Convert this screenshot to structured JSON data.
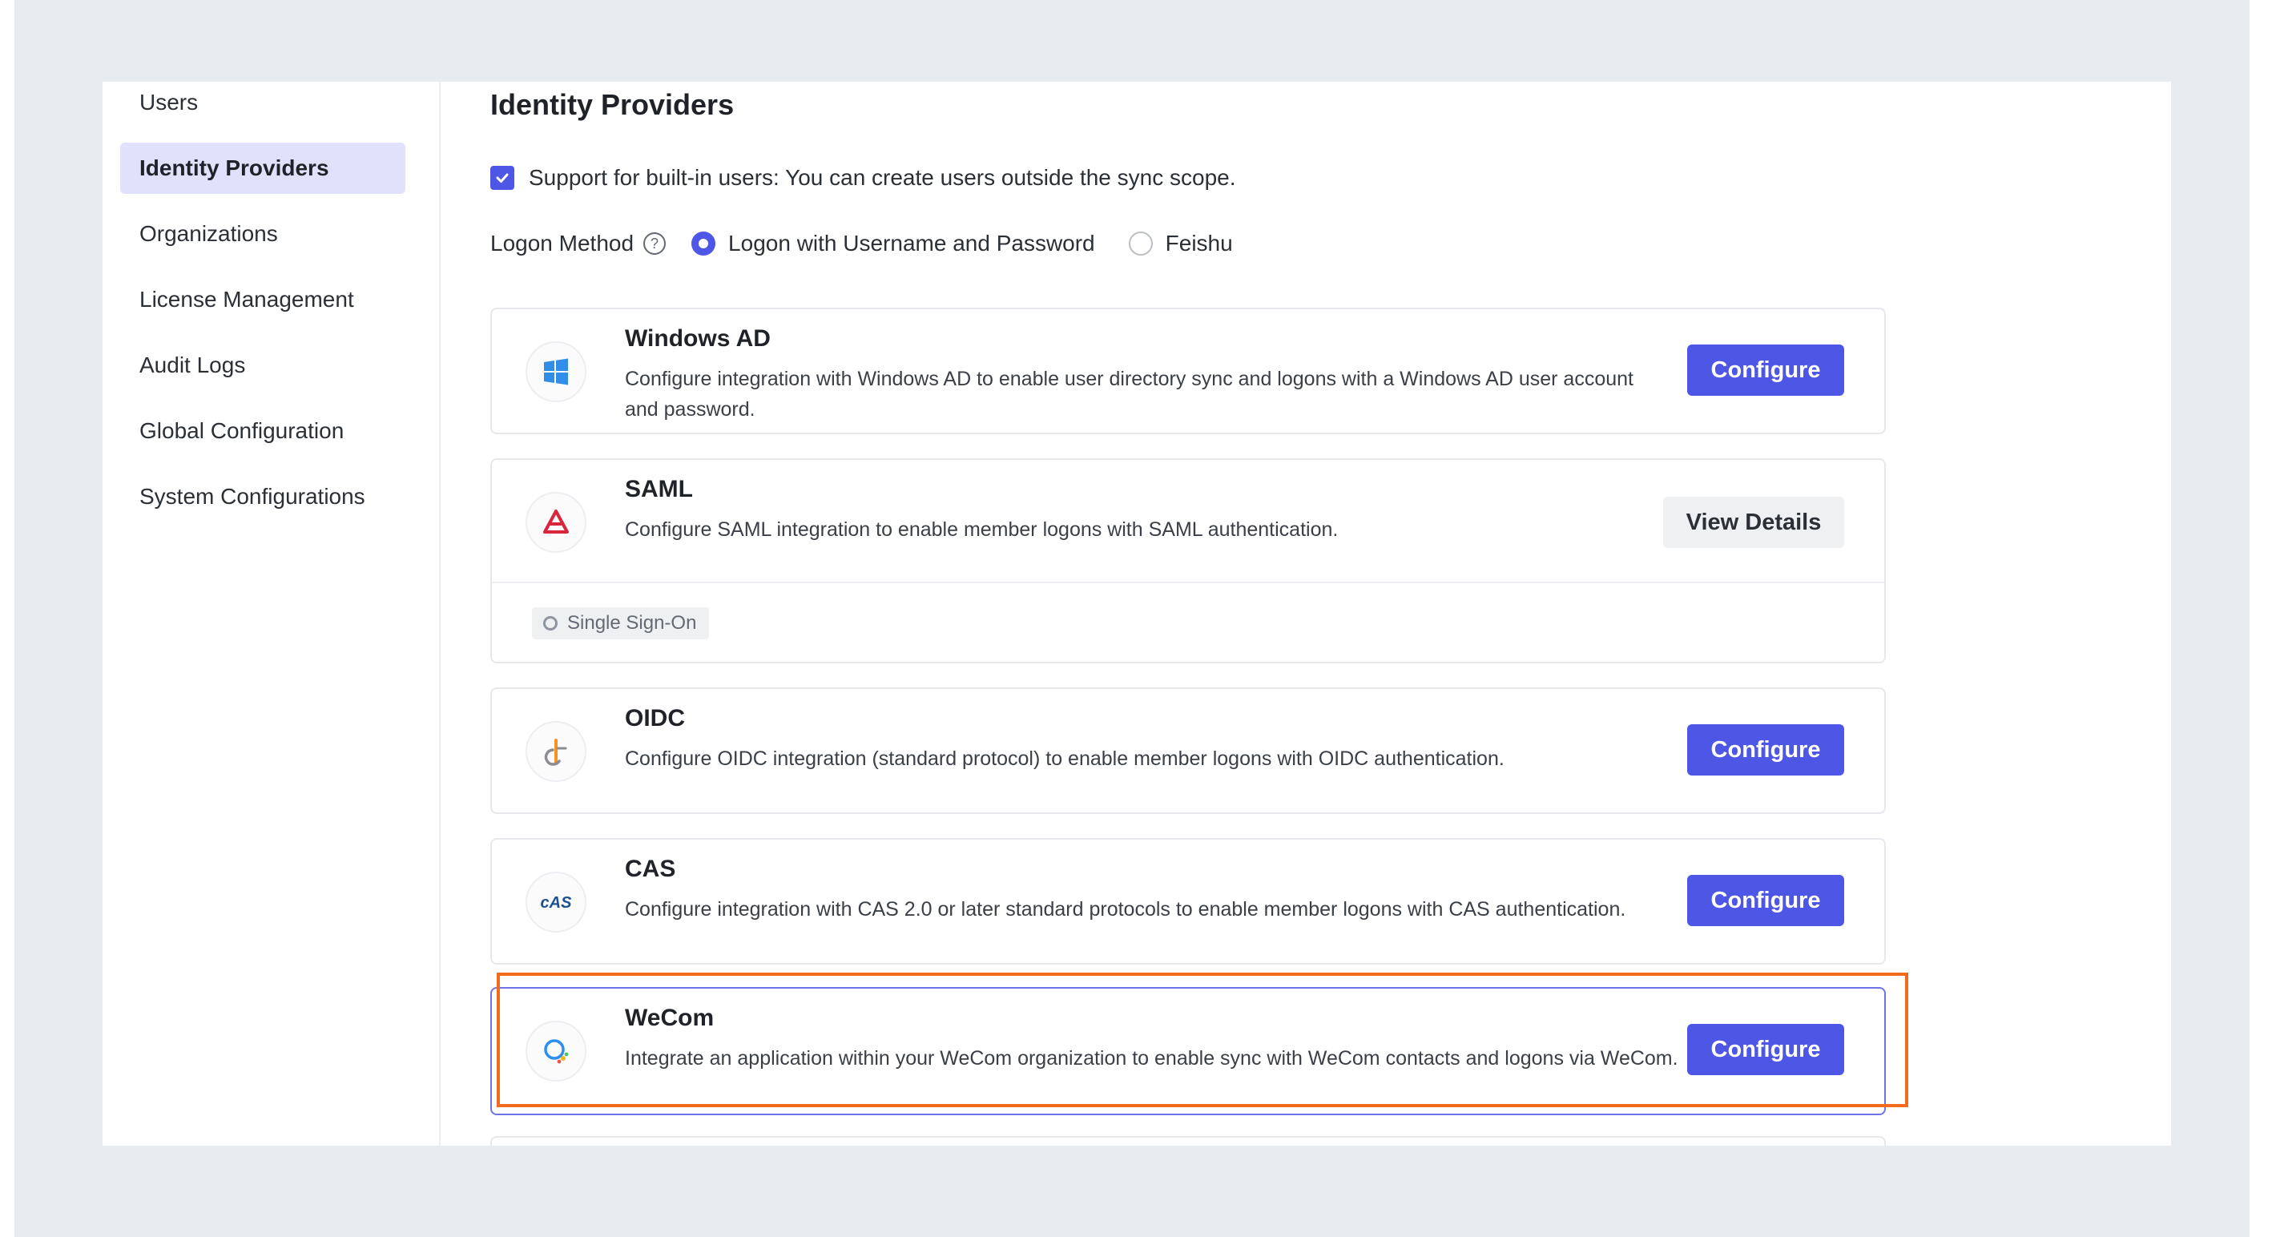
{
  "sidebar": {
    "items": [
      {
        "label": "Users"
      },
      {
        "label": "Identity Providers"
      },
      {
        "label": "Organizations"
      },
      {
        "label": "License Management"
      },
      {
        "label": "Audit Logs"
      },
      {
        "label": "Global Configuration"
      },
      {
        "label": "System Configurations"
      }
    ],
    "active": "Identity Providers"
  },
  "main": {
    "title": "Identity Providers",
    "builtin_users": {
      "checked": true,
      "label": "Support for built-in users: You can create users outside the sync scope."
    },
    "logon_method": {
      "label": "Logon Method",
      "help_icon": "question-circle-icon",
      "options": [
        {
          "label": "Logon with Username and Password",
          "selected": true
        },
        {
          "label": "Feishu",
          "selected": false
        }
      ]
    },
    "providers": [
      {
        "name": "Windows AD",
        "icon": "windows-logo-icon",
        "description": "Configure integration with Windows AD to enable user directory sync and logons with a Windows AD user account and password.",
        "action": "Configure"
      },
      {
        "name": "SAML",
        "icon": "saml-logo-icon",
        "description": "Configure SAML integration to enable member logons with SAML authentication.",
        "action": "View Details",
        "tag": "Single Sign-On"
      },
      {
        "name": "OIDC",
        "icon": "oidc-logo-icon",
        "description": "Configure OIDC integration (standard protocol) to enable member logons with OIDC authentication.",
        "action": "Configure"
      },
      {
        "name": "CAS",
        "icon": "cas-logo-icon",
        "description": "Configure integration with CAS 2.0 or later standard protocols to enable member logons with CAS authentication.",
        "action": "Configure"
      },
      {
        "name": "WeCom",
        "icon": "wecom-logo-icon",
        "description": "Integrate an application within your WeCom organization to enable sync with WeCom contacts and logons via WeCom.",
        "action": "Configure",
        "highlighted": true
      }
    ]
  },
  "colors": {
    "accent": "#4e56e6",
    "highlight": "#f26a1b",
    "active_nav_bg": "#e2e1fb",
    "page_bg": "#e8ebef"
  }
}
